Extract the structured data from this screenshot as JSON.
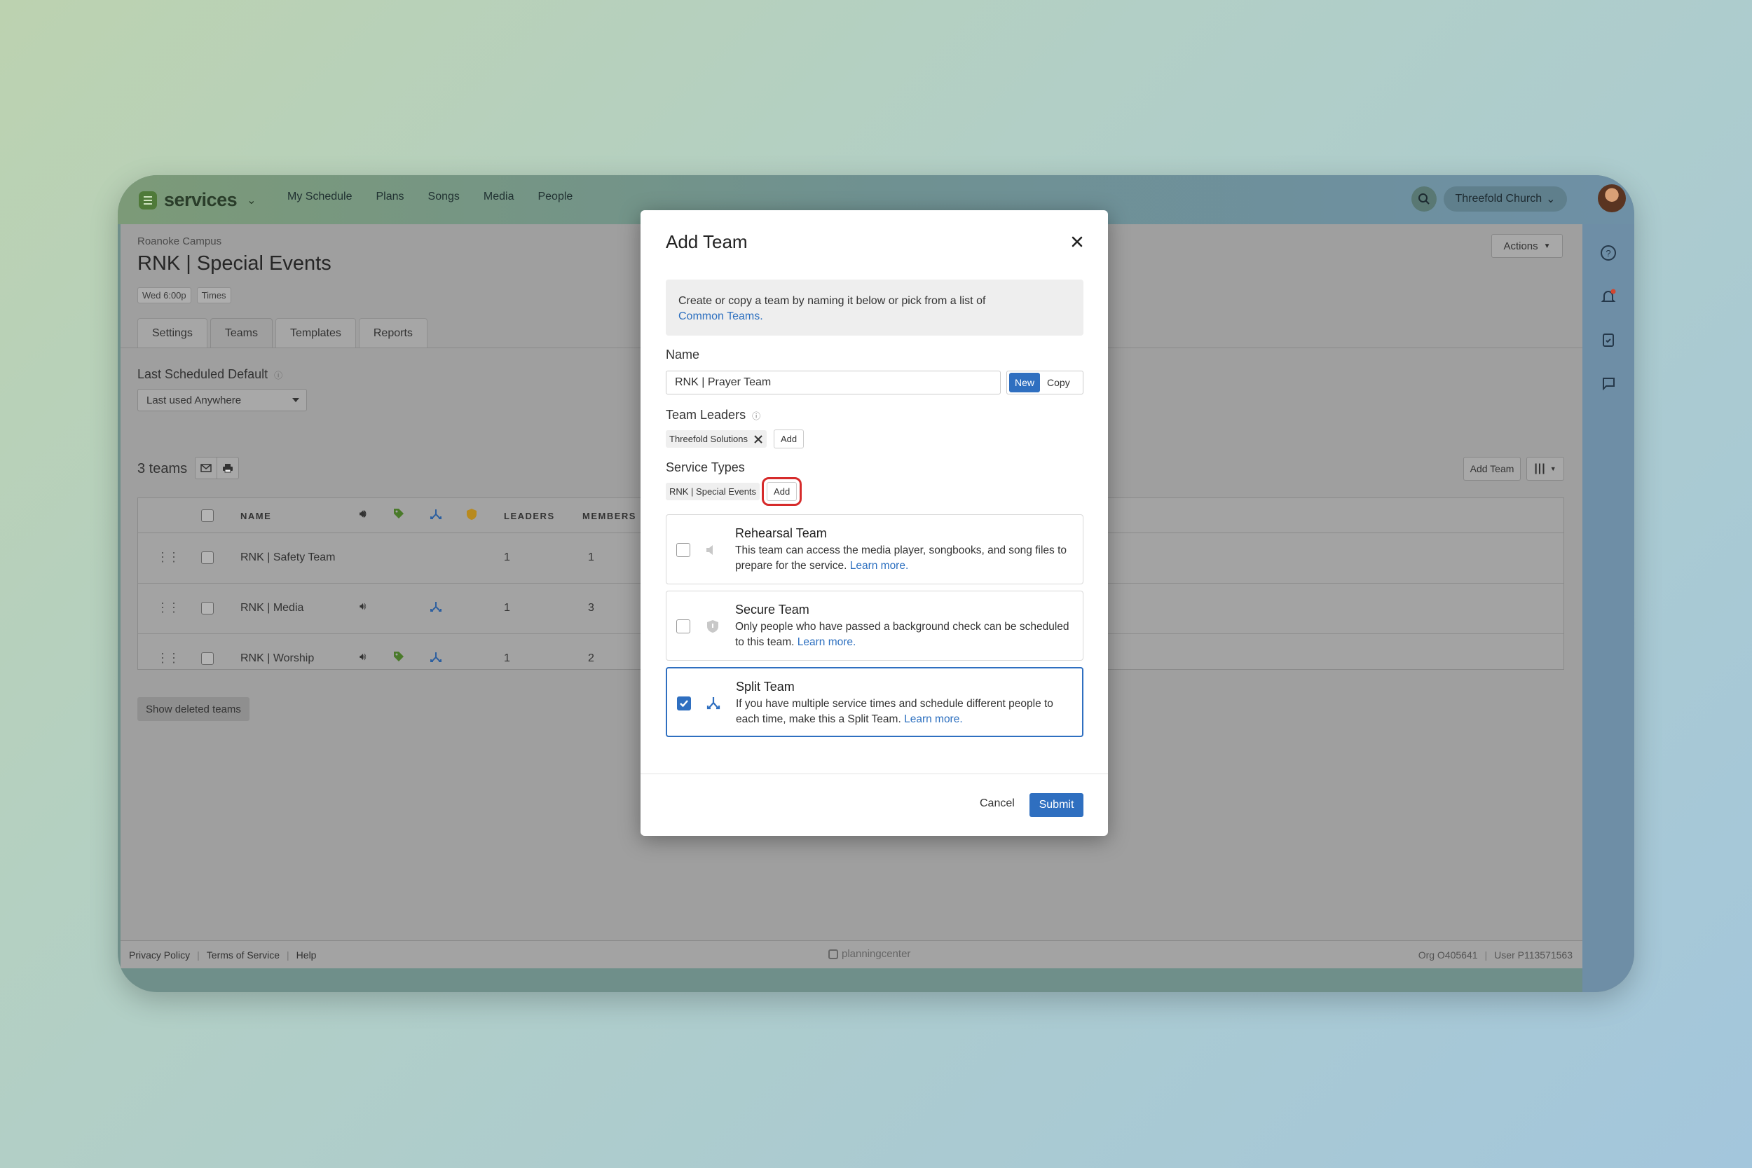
{
  "app": {
    "name": "services",
    "colors": {
      "brand_green": "#4f7a39",
      "accent_blue": "#2f6fc0",
      "highlight_red": "#d62b2b"
    }
  },
  "nav": {
    "items": [
      "My Schedule",
      "Plans",
      "Songs",
      "Media",
      "People"
    ]
  },
  "header": {
    "org": "Threefold Church"
  },
  "page": {
    "campus": "Roanoke Campus",
    "title": "RNK | Special Events",
    "chips": [
      "Wed 6:00p",
      "Times"
    ],
    "actions_label": "Actions",
    "tabs": [
      "Settings",
      "Teams",
      "Templates",
      "Reports"
    ],
    "active_tab": "Teams",
    "last_scheduled_label": "Last Scheduled Default",
    "last_scheduled_value": "Last used Anywhere",
    "teams_count": "3 teams",
    "add_team_label": "Add Team",
    "show_deleted": "Show deleted teams"
  },
  "table": {
    "headers": {
      "name": "NAME",
      "leaders": "LEADERS",
      "members": "MEMBERS"
    },
    "rows": [
      {
        "name": "RNK | Safety Team",
        "leaders": "1",
        "members": "1"
      },
      {
        "name": "RNK | Media",
        "leaders": "1",
        "members": "3"
      },
      {
        "name": "RNK | Worship",
        "leaders": "1",
        "members": "2"
      }
    ]
  },
  "footer": {
    "links": [
      "Privacy Policy",
      "Terms of Service",
      "Help"
    ],
    "brand": "planningcenter",
    "org_id": "Org O405641",
    "user_id": "User P113571563"
  },
  "modal": {
    "title": "Add Team",
    "info_text": "Create or copy a team by naming it below or pick from a list of",
    "info_link": "Common Teams.",
    "name_label": "Name",
    "name_value": "RNK | Prayer Team",
    "new_label": "New",
    "copy_label": "Copy",
    "leaders_label": "Team Leaders",
    "leader_tag": "Threefold Solutions",
    "add_label": "Add",
    "service_types_label": "Service Types",
    "service_type_tag": "RNK | Special Events",
    "options": [
      {
        "title": "Rehearsal Team",
        "desc": "This team can access the media player, songbooks, and song files to prepare for the service.",
        "link": "Learn more.",
        "checked": false
      },
      {
        "title": "Secure Team",
        "desc": "Only people who have passed a background check can be scheduled to this team.",
        "link": "Learn more.",
        "checked": false
      },
      {
        "title": "Split Team",
        "desc": "If you have multiple service times and schedule different people to each time, make this a Split Team.",
        "link": "Learn more.",
        "checked": true
      }
    ],
    "cancel_label": "Cancel",
    "submit_label": "Submit"
  }
}
